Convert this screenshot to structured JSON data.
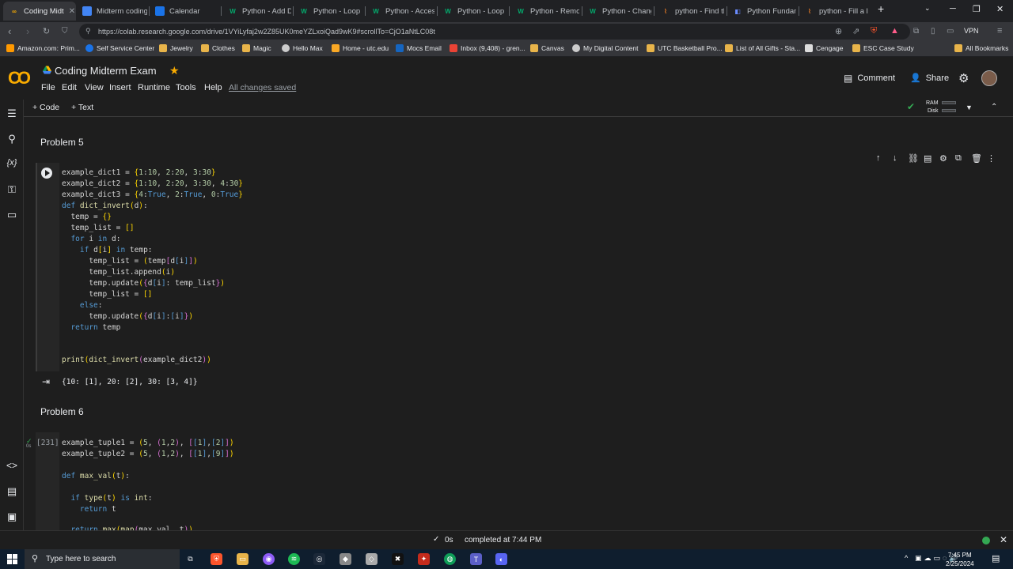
{
  "browser": {
    "tabs": [
      {
        "label": "Coding Midt",
        "active": true
      },
      {
        "label": "Midterm coding"
      },
      {
        "label": "Calendar"
      },
      {
        "label": "Python - Add Di"
      },
      {
        "label": "Python - Loop D"
      },
      {
        "label": "Python - Access"
      },
      {
        "label": "Python - Loop D"
      },
      {
        "label": "Python - Remov"
      },
      {
        "label": "Python - Change"
      },
      {
        "label": "python - Find the"
      },
      {
        "label": "Python Fundame"
      },
      {
        "label": "python - Fill a list"
      }
    ],
    "url": "https://colab.research.google.com/drive/1VYiLyfaj2w2Z85UK0meYZLxoiQad9wK9#scrollTo=CjO1aNtLC08t",
    "vpn_label": "VPN",
    "bookmarks": [
      "Amazon.com: Prim...",
      "Self Service Center",
      "Jewelry",
      "Clothes",
      "Magic",
      "Hello Max",
      "Home - utc.edu",
      "Mocs Email",
      "Inbox (9,408) - gren...",
      "Canvas",
      "My Digital Content",
      "UTC Basketball Pro...",
      "List of All Gifts - Sta...",
      "Cengage",
      "ESC Case Study"
    ],
    "all_bookmarks": "All Bookmarks"
  },
  "colab": {
    "logo": "CO",
    "title": "Coding Midterm Exam",
    "menus": [
      "File",
      "Edit",
      "View",
      "Insert",
      "Runtime",
      "Tools",
      "Help"
    ],
    "saved_status": "All changes saved",
    "comment_label": "Comment",
    "share_label": "Share",
    "toolbar": {
      "code_label": "+ Code",
      "text_label": "+ Text",
      "ram": "RAM",
      "disk": "Disk"
    }
  },
  "notebook": {
    "problem5_title": "Problem 5",
    "cell5_lines": [
      "example_dict1 = {1:10, 2:20, 3:30}",
      "example_dict2 = {1:10, 2:20, 3:30, 4:30}",
      "example_dict3 = {4:True, 2:True, 0:True}",
      "def dict_invert(d):",
      "  temp = {}",
      "  temp_list = []",
      "  for i in d:",
      "    if d[i] in temp:",
      "      temp_list = (temp[d[i]])",
      "      temp_list.append(i)",
      "      temp.update({d[i]: temp_list})",
      "      temp_list = []",
      "    else:",
      "      temp.update({d[i]:[i]})",
      "  return temp",
      "",
      "",
      "print(dict_invert(example_dict2))"
    ],
    "cell5_output": "{10: [1], 20: [2], 30: [3, 4]}",
    "problem6_title": "Problem 6",
    "cell6_exec": "[231]",
    "cell6_time": "0s",
    "cell6_lines": [
      "example_tuple1 = (5, (1,2), [[1],[2]])",
      "example_tuple2 = (5, (1,2), [[1],[9]])",
      "",
      "def max_val(t):",
      "",
      "  if type(t) is int:",
      "    return t",
      "",
      "  return max(map(max_val, t))"
    ]
  },
  "status": {
    "time": "0s",
    "text": "completed at 7:44 PM"
  },
  "taskbar": {
    "search_placeholder": "Type here to search",
    "clock_time": "7:45 PM",
    "clock_date": "2/25/2024"
  }
}
